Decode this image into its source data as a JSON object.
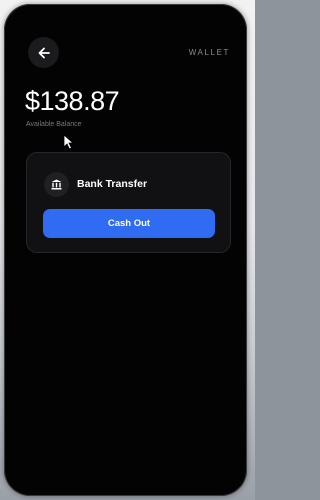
{
  "header": {
    "section_label": "WALLET"
  },
  "balance": {
    "amount": "$138.87",
    "caption": "Available Balance"
  },
  "payout": {
    "method_label": "Bank Transfer",
    "method_icon": "bank-icon",
    "action_label": "Cash Out"
  },
  "colors": {
    "background": "#030303",
    "card": "#111113",
    "accent": "#2f6cf2",
    "text_primary": "#ffffff",
    "text_muted": "#8a8a8e"
  }
}
